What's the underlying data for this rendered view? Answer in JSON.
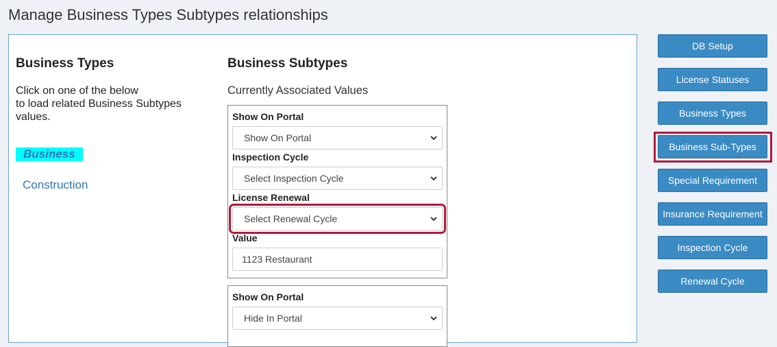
{
  "page": {
    "title": "Manage Business Types Subtypes relationships"
  },
  "business_types": {
    "heading": "Business Types",
    "instructions": [
      "Click on one of the below",
      "to load related Business Subtypes",
      "values."
    ],
    "items": [
      {
        "label": "Business",
        "selected": true
      },
      {
        "label": "Construction",
        "selected": false
      }
    ]
  },
  "business_subtypes": {
    "heading": "Business Subtypes",
    "associated_label": "Currently Associated Values",
    "entries": [
      {
        "show_on_portal_label": "Show On Portal",
        "show_on_portal_value": "Show On Portal",
        "inspection_cycle_label": "Inspection Cycle",
        "inspection_cycle_value": "Select Inspection Cycle",
        "license_renewal_label": "License Renewal",
        "license_renewal_value": "Select Renewal Cycle",
        "value_label": "Value",
        "value": "1123 Restaurant"
      },
      {
        "show_on_portal_label": "Show On Portal",
        "show_on_portal_value": "Hide In Portal"
      }
    ]
  },
  "sidebar": {
    "buttons": [
      {
        "label": "DB Setup"
      },
      {
        "label": "License Statuses"
      },
      {
        "label": "Business Types"
      },
      {
        "label": "Business Sub-Types",
        "active": true
      },
      {
        "label": "Special Requirement"
      },
      {
        "label": "Insurance Requirement"
      },
      {
        "label": "Inspection Cycle"
      },
      {
        "label": "Renewal Cycle"
      }
    ]
  },
  "colors": {
    "button_bg": "#3a8ac3",
    "selected_highlight": "#00ffff",
    "link": "#2f79b5",
    "annotation_red": "#b5183c"
  },
  "icons": {
    "select_chevron": "chevron-down-icon"
  }
}
